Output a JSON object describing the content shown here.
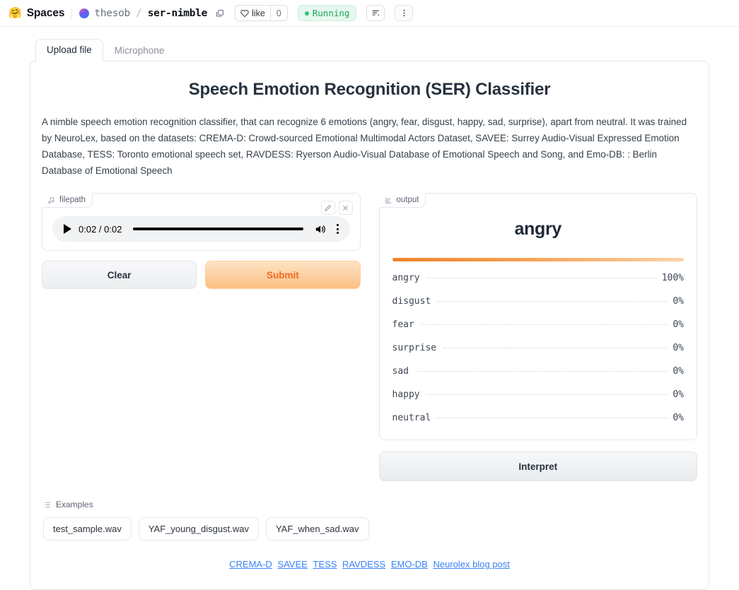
{
  "header": {
    "logo_emoji": "🤗",
    "product": "Spaces",
    "owner": "thesob",
    "slash": "/",
    "repo": "ser-nimble",
    "like_label": "like",
    "like_count": "0",
    "status": "Running",
    "accent_green": "#18a957"
  },
  "tabs": [
    {
      "label": "Upload file",
      "active": true
    },
    {
      "label": "Microphone",
      "active": false
    }
  ],
  "main": {
    "title": "Speech Emotion Recognition (SER) Classifier",
    "description": "A nimble speech emotion recognition classifier, that can recognize 6 emotions (angry, fear, disgust, happy, sad, surprise), apart from neutral. It was trained by NeuroLex, based on the datasets: CREMA-D: Crowd-sourced Emotional Multimodal Actors Dataset, SAVEE: Surrey Audio-Visual Expressed Emotion Database, TESS: Toronto emotional speech set, RAVDESS: Ryerson Audio-Visual Database of Emotional Speech and Song, and Emo-DB: : Berlin Database of Emotional Speech"
  },
  "input": {
    "block_label": "filepath",
    "audio": {
      "time": "0:02 / 0:02",
      "progress_percent": 100
    },
    "clear_label": "Clear",
    "submit_label": "Submit"
  },
  "output": {
    "block_label": "output",
    "top_label": "angry",
    "interpret_label": "Interpret",
    "confidences": [
      {
        "label": "angry",
        "value": "100%",
        "percent": 100
      },
      {
        "label": "disgust",
        "value": "0%",
        "percent": 0
      },
      {
        "label": "fear",
        "value": "0%",
        "percent": 0
      },
      {
        "label": "surprise",
        "value": "0%",
        "percent": 0
      },
      {
        "label": "sad",
        "value": "0%",
        "percent": 0
      },
      {
        "label": "happy",
        "value": "0%",
        "percent": 0
      },
      {
        "label": "neutral",
        "value": "0%",
        "percent": 0
      }
    ]
  },
  "examples": {
    "title": "Examples",
    "items": [
      {
        "label": "test_sample.wav"
      },
      {
        "label": "YAF_young_disgust.wav"
      },
      {
        "label": "YAF_when_sad.wav"
      }
    ]
  },
  "footer": {
    "links": [
      {
        "label": "CREMA-D"
      },
      {
        "label": "SAVEE"
      },
      {
        "label": "TESS"
      },
      {
        "label": "RAVDESS"
      },
      {
        "label": "EMO-DB"
      },
      {
        "label": "Neurolex blog post"
      }
    ]
  },
  "colors": {
    "accent_orange": "#ef6b22",
    "bar_start": "#ef8128",
    "bar_end": "#fcd2a5",
    "link_blue": "#3b82f6"
  }
}
